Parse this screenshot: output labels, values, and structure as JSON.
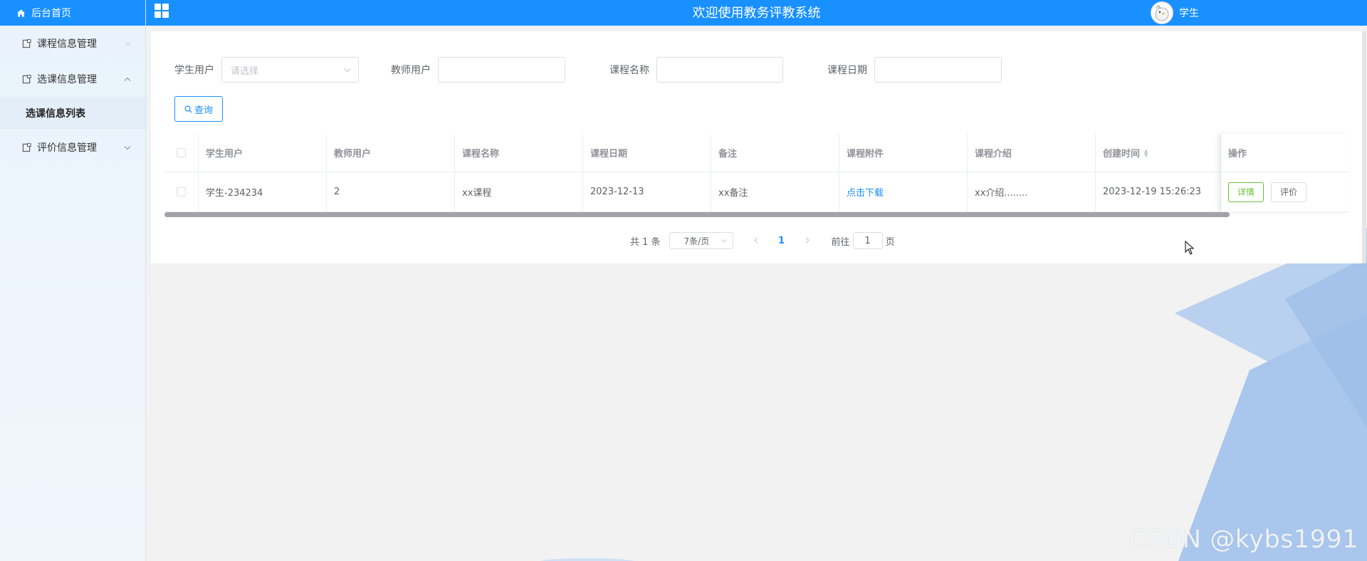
{
  "header": {
    "title": "欢迎使用教务评教系统",
    "user_name": "学生"
  },
  "sidebar": {
    "home_label": "后台首页",
    "items": [
      {
        "label": "课程信息管理",
        "expanded": false
      },
      {
        "label": "选课信息管理",
        "expanded": true
      },
      {
        "label": "评价信息管理",
        "expanded": false
      }
    ],
    "active_sub": "选课信息列表"
  },
  "filters": {
    "student_label": "学生用户",
    "student_placeholder": "请选择",
    "teacher_label": "教师用户",
    "course_name_label": "课程名称",
    "course_date_label": "课程日期",
    "query_label": "查询"
  },
  "table": {
    "columns": [
      "学生用户",
      "教师用户",
      "课程名称",
      "课程日期",
      "备注",
      "课程附件",
      "课程介绍",
      "创建时间",
      "操作"
    ],
    "rows": [
      {
        "student": "学生-234234",
        "teacher": "2",
        "course_name": "xx课程",
        "course_date": "2023-12-13",
        "remark": "xx备注",
        "attachment": "点击下载",
        "intro": "xx介绍........",
        "created": "2023-12-19 15:26:23",
        "detail_label": "详情",
        "eval_label": "评价"
      }
    ]
  },
  "pagination": {
    "total_text": "共 1 条",
    "page_size": "7条/页",
    "current_page": "1",
    "goto_prefix": "前往",
    "goto_value": "1",
    "goto_suffix": "页"
  },
  "watermark": "CSDN @kybs1991",
  "colors": {
    "primary": "#1890ff",
    "success": "#67c23a"
  }
}
